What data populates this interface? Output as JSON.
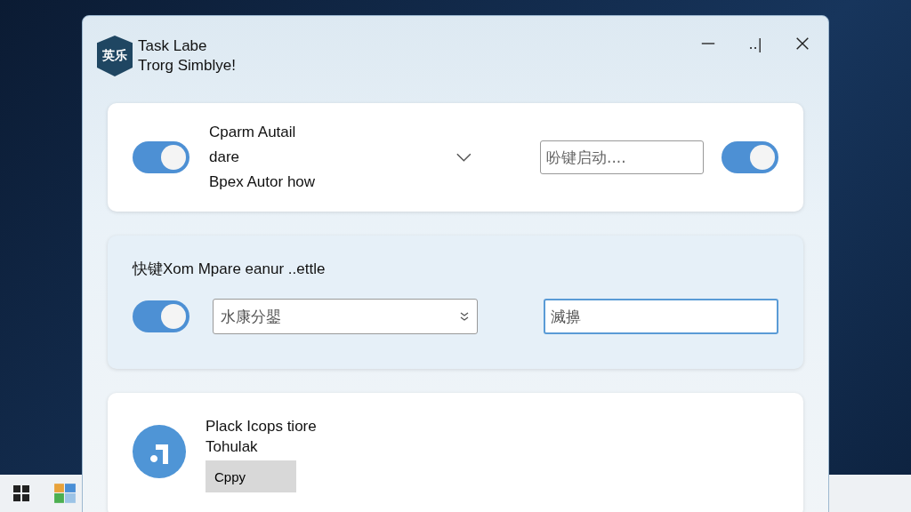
{
  "window": {
    "title": "Task Labe",
    "subtitle": "Trorg Simblye!",
    "logo_text": "英乐",
    "maximize_label": "..|"
  },
  "cards": [
    {
      "kind": "toggle_row",
      "toggle_on": true,
      "lines": [
        "Cparm Autail dare",
        "Bpex Autor how"
      ],
      "input_placeholder": "吩键启动....",
      "toggle2_on": true
    },
    {
      "kind": "form_row",
      "heading": "快键Xom Mpare eanur ..ettle",
      "toggle_on": true,
      "select_value": "水康分鑍",
      "input_value": "滅擤"
    },
    {
      "kind": "app_row",
      "lines": [
        "Plack Icops tiore",
        "Tohulak"
      ],
      "button_label": "Cppy"
    }
  ]
}
